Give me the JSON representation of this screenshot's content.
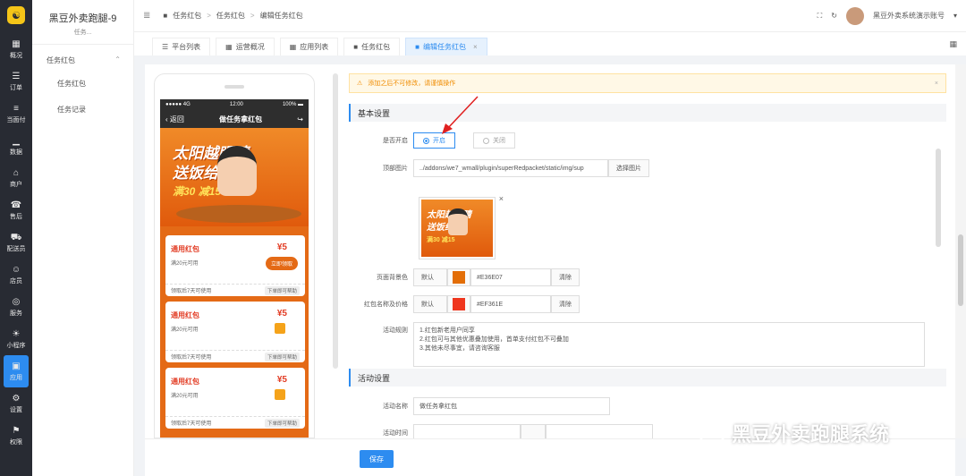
{
  "nav": {
    "logo": "☯",
    "items": [
      {
        "icon": "▦",
        "label": "概况"
      },
      {
        "icon": "☰",
        "label": "订单"
      },
      {
        "icon": "≡",
        "label": "当面付"
      },
      {
        "icon": "▁",
        "label": "数据"
      },
      {
        "icon": "⌂",
        "label": "商户"
      },
      {
        "icon": "☎",
        "label": "售后"
      },
      {
        "icon": "⛟",
        "label": "配送员"
      },
      {
        "icon": "☺",
        "label": "店员"
      },
      {
        "icon": "◎",
        "label": "服务"
      },
      {
        "icon": "☀",
        "label": "小程序"
      },
      {
        "icon": "▣",
        "label": "应用"
      },
      {
        "icon": "⚙",
        "label": "设置"
      },
      {
        "icon": "⚑",
        "label": "权限"
      }
    ]
  },
  "subnav": {
    "shop_name": "黑豆外卖跑腿-9",
    "shop_sub": "任务...",
    "group": "任务红包",
    "group_arrow": "⌃",
    "items": [
      "任务红包",
      "任务记录"
    ]
  },
  "topbar": {
    "menu_icon": "≣",
    "crumbs": [
      "任务红包",
      "任务红包",
      "编辑任务红包"
    ],
    "sep": ">",
    "account": "黑豆外卖系统演示账号",
    "dropdown": "▾",
    "fullscreen_icon": "⛶",
    "refresh_icon": "↻"
  },
  "tabs": [
    {
      "label": "平台列表"
    },
    {
      "label": "运营概况"
    },
    {
      "label": "应用列表"
    },
    {
      "label": "任务红包"
    },
    {
      "label": "编辑任务红包",
      "close": "×"
    }
  ],
  "phone": {
    "status_left": "●●●●● 4G",
    "status_time": "12:00",
    "status_right": "100% ▬",
    "back": "‹ 返回",
    "title": "做任务拿红包",
    "share": "↪",
    "banner_line1": "太阳越眼睛",
    "banner_line2": "送饭给你",
    "banner_line3": "满30 减15",
    "cards": [
      {
        "name": "通用红包",
        "amount": "¥5",
        "cond": "满20元可用",
        "foot": "领取后7天可使用",
        "tag": "下单即可帮助",
        "action": "立即领取"
      },
      {
        "name": "通用红包",
        "amount": "¥5",
        "cond": "满20元可用",
        "foot": "领取后7天可使用",
        "tag": "下单即可帮助"
      },
      {
        "name": "通用红包",
        "amount": "¥5",
        "cond": "满20元可用",
        "foot": "领取后7天可使用",
        "tag": "下单即可帮助"
      }
    ]
  },
  "form": {
    "alert": "添加之后不可修改，请谨慎操作",
    "alert_close": "×",
    "section_basic": "基本设置",
    "enable_label": "是否开启",
    "enable_on": "开启",
    "enable_off": "关闭",
    "top_image_label": "顶部图片",
    "top_image_value": "../addons/we7_wmall/plugin/superRedpacket/static/img/sup",
    "select_image": "选择图片",
    "remove_image": "×",
    "preview_line1": "太阳越眼睛",
    "preview_line2": "送饭给你",
    "preview_line3": "满30 减15",
    "bg_color_label": "页面背景色",
    "default": "默认",
    "clear": "清除",
    "bg_color": "#E36E07",
    "name_price_label": "红包名称及价格",
    "name_price_color": "#EF361E",
    "rules_label": "活动规则",
    "rules": [
      "1.红包新老用户同享",
      "2.红包可与其他优惠叠加使用，首单支付红包不可叠加",
      "3.其他未尽事宜，请咨询客服"
    ],
    "section_activity": "活动设置",
    "activity_name_label": "活动名称",
    "activity_name_value": "做任务拿红包",
    "activity_time_label": "活动时间"
  },
  "save": "保存",
  "watermark": "黑豆外卖跑腿系统",
  "colors": {
    "accent": "#2d8cf0",
    "orange": "#E36E07",
    "red": "#EF361E"
  }
}
